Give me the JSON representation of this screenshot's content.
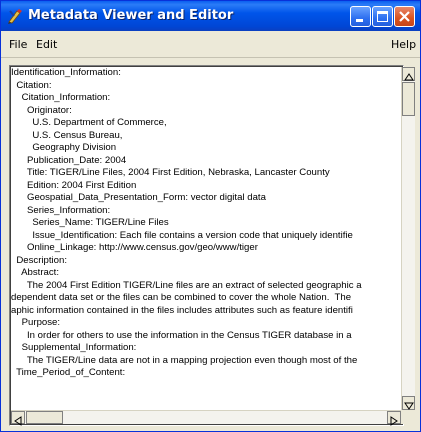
{
  "window": {
    "title": "Metadata Viewer and Editor",
    "controls": [
      "minimize",
      "maximize",
      "close"
    ]
  },
  "menu": {
    "file": "File",
    "edit": "Edit",
    "help": "Help"
  },
  "content": {
    "lines": [
      "Identification_Information:",
      "  Citation:",
      "    Citation_Information:",
      "      Originator:",
      "        U.S. Department of Commerce,",
      "        U.S. Census Bureau,",
      "        Geography Division",
      "      Publication_Date: 2004",
      "      Title: TIGER/Line Files, 2004 First Edition, Nebraska, Lancaster County",
      "      Edition: 2004 First Edition",
      "      Geospatial_Data_Presentation_Form: vector digital data",
      "      Series_Information:",
      "        Series_Name: TIGER/Line Files",
      "        Issue_Identification: Each file contains a version code that uniquely identifie",
      "      Online_Linkage: http://www.census.gov/geo/www/tiger",
      "  Description:",
      "    Abstract:",
      "      The 2004 First Edition TIGER/Line files are an extract of selected geographic a",
      "dependent data set or the files can be combined to cover the whole Nation.  The",
      "aphic information contained in the files includes attributes such as feature identifi",
      "    Purpose:",
      "      In order for others to use the information in the Census TIGER database in a",
      "    Supplemental_Information:",
      "      The TIGER/Line data are not in a mapping projection even though most of the",
      "  Time_Period_of_Content:"
    ]
  },
  "icons": {
    "app": "pencil-tool-icon",
    "scroll_up": "arrow-up-icon",
    "scroll_down": "arrow-down-icon",
    "scroll_left": "arrow-left-icon",
    "scroll_right": "arrow-right-icon"
  },
  "colors": {
    "titlebar": "#0055ea",
    "close_button": "#d9531f",
    "window_bg": "#ece9d8"
  },
  "scroll": {
    "vertical_position": 0,
    "horizontal_position": 0
  }
}
